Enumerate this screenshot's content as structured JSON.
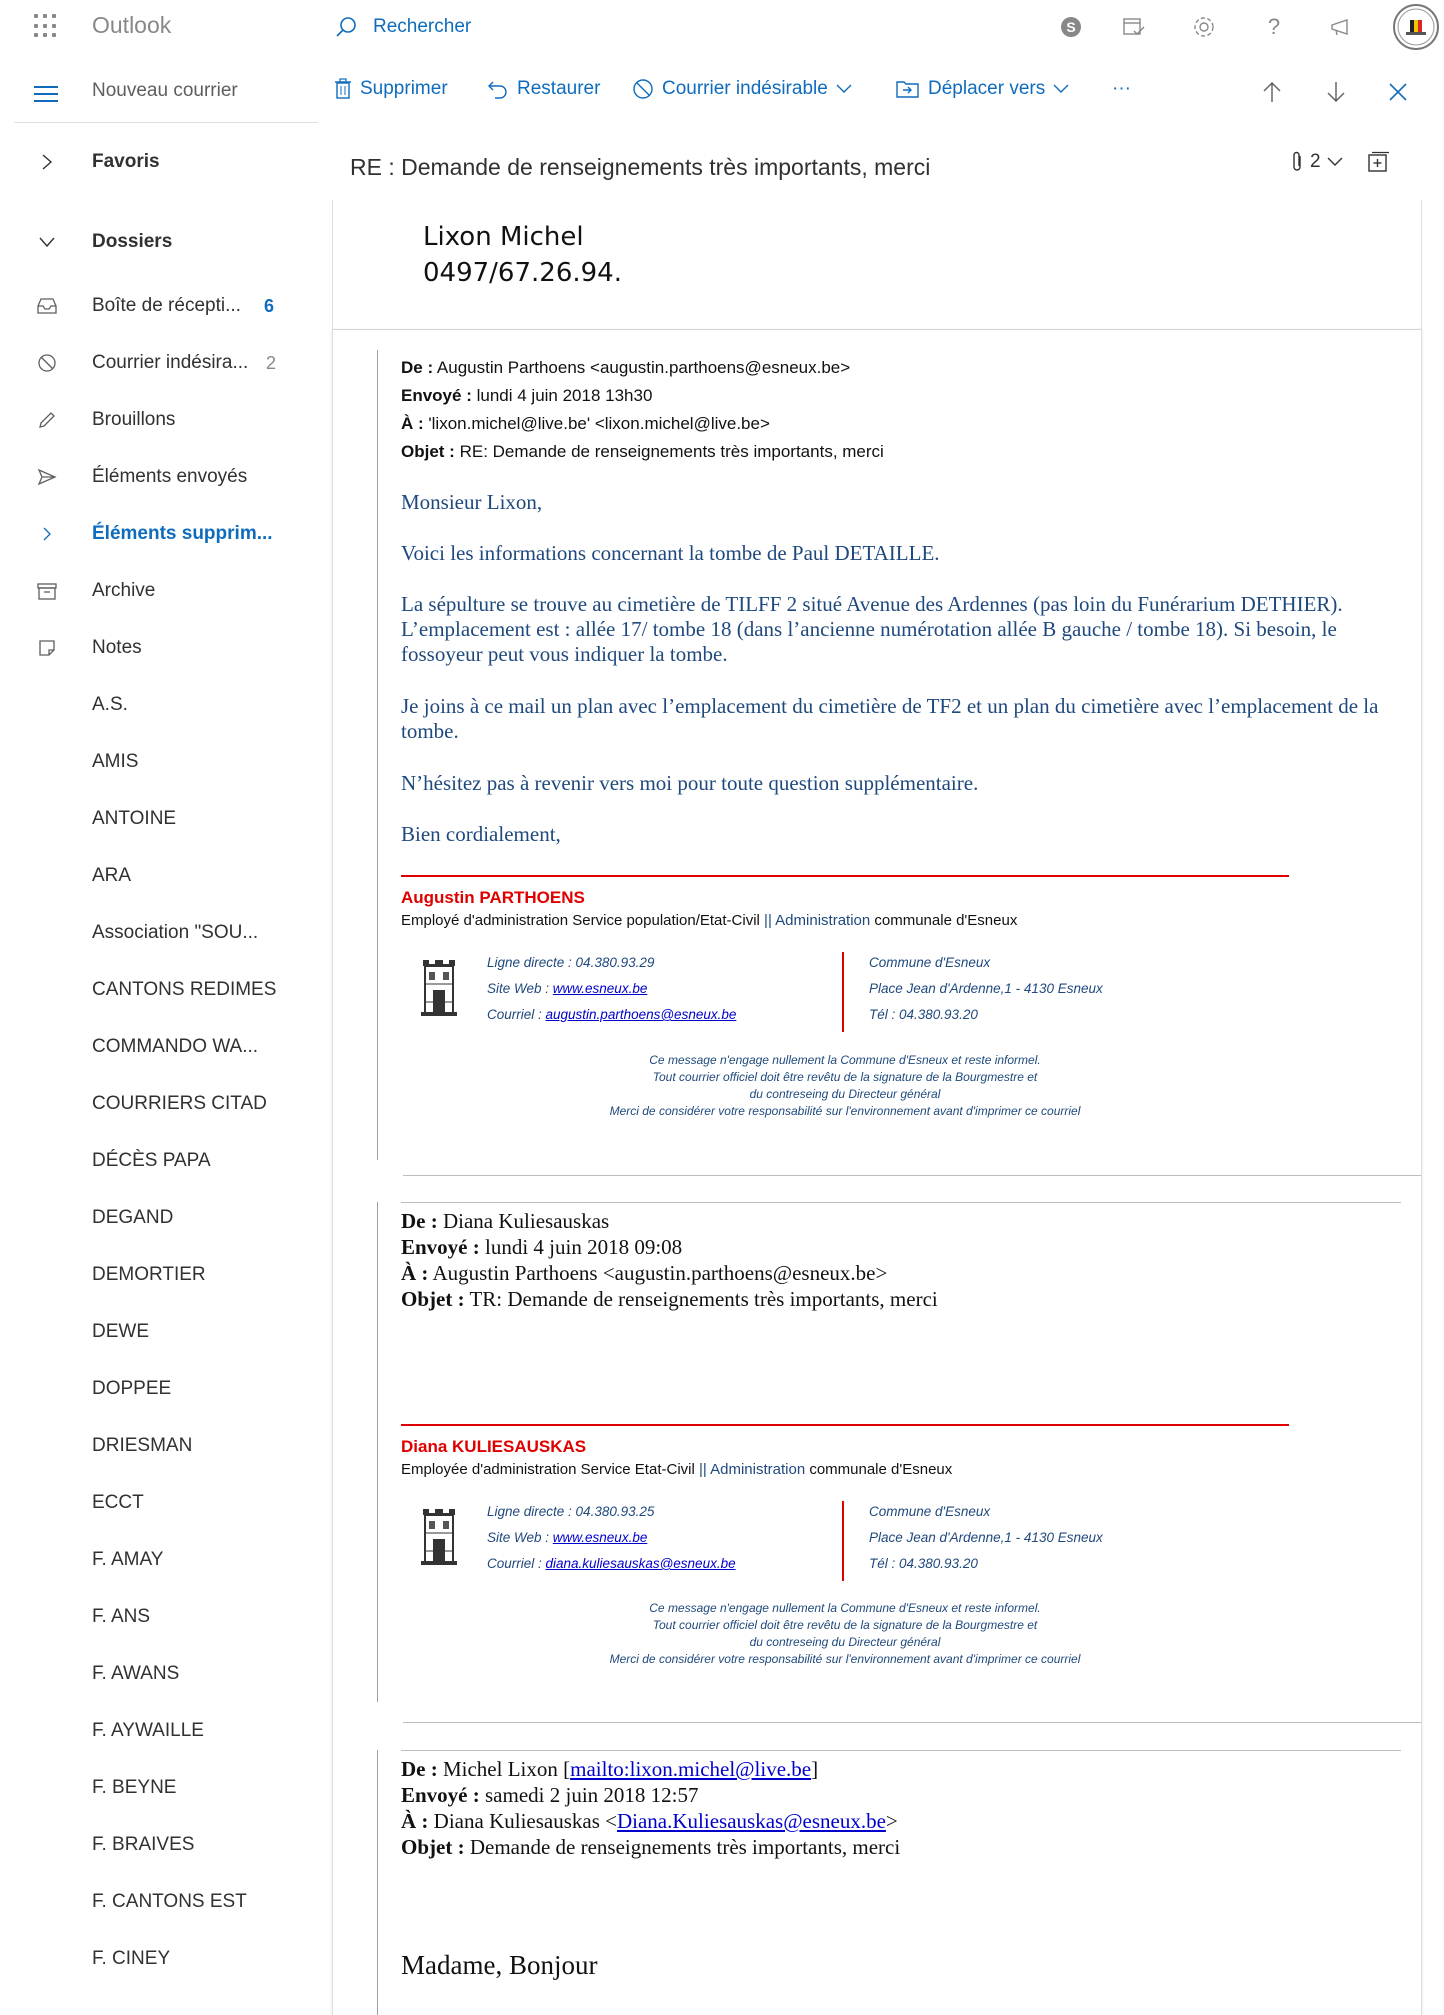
{
  "app": {
    "title": "Outlook",
    "search_label": "Rechercher",
    "new_mail": "Nouveau courrier"
  },
  "toolbar": {
    "delete": "Supprimer",
    "restore": "Restaurer",
    "junk": "Courrier indésirable",
    "move": "Déplacer vers",
    "more": "···"
  },
  "sidebar": {
    "favorites": "Favoris",
    "folders": "Dossiers",
    "items": [
      {
        "label": "Boîte de récepti...",
        "count": "6"
      },
      {
        "label": "Courrier indésira...",
        "count": "2"
      },
      {
        "label": "Brouillons",
        "count": ""
      },
      {
        "label": "Éléments envoyés",
        "count": ""
      },
      {
        "label": "Éléments supprim...",
        "count": ""
      },
      {
        "label": "Archive",
        "count": ""
      },
      {
        "label": "Notes",
        "count": ""
      }
    ],
    "custom": [
      "A.S.",
      "AMIS",
      "ANTOINE",
      "ARA",
      "Association \"SOU...",
      "CANTONS REDIMES",
      "COMMANDO WA...",
      "COURRIERS CITAD",
      "DÉCÈS PAPA",
      "DEGAND",
      "DEMORTIER",
      "DEWE",
      "DOPPEE",
      "DRIESMAN",
      "ECCT",
      "F. AMAY",
      "F. ANS",
      "F. AWANS",
      "F. AYWAILLE",
      "F. BEYNE",
      "F. BRAIVES",
      "F. CANTONS EST",
      "F. CINEY"
    ]
  },
  "message": {
    "subject": "RE : Demande de renseignements très importants, merci",
    "attachments_count": "2",
    "signature_name": "Lixon Michel",
    "signature_phone": "0497/67.26.94."
  },
  "mail1": {
    "from_label": "De :",
    "from": "Augustin Parthoens <augustin.parthoens@esneux.be>",
    "sent_label": "Envoyé :",
    "sent": "lundi 4 juin 2018 13h30",
    "to_label": "À :",
    "to": "'lixon.michel@live.be' <lixon.michel@live.be>",
    "subject_label": "Objet :",
    "subject": "RE: Demande de renseignements très importants, merci",
    "greeting": "Monsieur Lixon,",
    "p1": "Voici les informations concernant la tombe de Paul DETAILLE.",
    "p2": "La sépulture se trouve au cimetière de TILFF 2 situé Avenue des Ardennes (pas loin du Funérarium DETHIER). L’emplacement est : allée 17/ tombe 18 (dans l’ancienne numérotation allée B gauche / tombe 18). Si besoin, le fossoyeur peut vous indiquer la tombe.",
    "p3": "Je joins à ce mail un plan avec l’emplacement du cimetière de TF2 et un plan du cimetière avec l’emplacement de la tombe.",
    "p4": "N’hésitez pas à revenir vers moi pour toute question supplémentaire.",
    "closing": "Bien cordialement,",
    "sig_name": "Augustin PARTHOENS",
    "sig_role_a": "Employé d'administration Service population/Etat-Civil ",
    "sig_role_b": "|| Administration",
    "sig_role_c": " communale d'Esneux",
    "line_direct": "Ligne directe : 04.380.93.29",
    "site_label": "Site Web : ",
    "site": "www.esneux.be",
    "mail_label": "Courriel : ",
    "mail": "augustin.parthoens@esneux.be",
    "commune": "Commune d'Esneux",
    "address": "Place Jean d'Ardenne,1 - 4130 Esneux",
    "tel": "Tél : 04.380.93.20"
  },
  "mail2": {
    "from_label": "De :",
    "from": "Diana Kuliesauskas",
    "sent_label": "Envoyé :",
    "sent": "lundi 4 juin 2018 09:08",
    "to_label": "À :",
    "to": "Augustin Parthoens <augustin.parthoens@esneux.be>",
    "subject_label": "Objet :",
    "subject": "TR: Demande de renseignements très importants, merci",
    "sig_name": "Diana KULIESAUSKAS",
    "sig_role_a": "Employée d'administration Service Etat-Civil ",
    "sig_role_b": "|| Administration",
    "sig_role_c": " communale d'Esneux",
    "line_direct": "Ligne directe : 04.380.93.25",
    "site_label": "Site Web : ",
    "site": "www.esneux.be",
    "mail_label": "Courriel : ",
    "mail": "diana.kuliesauskas@esneux.be",
    "commune": "Commune d'Esneux",
    "address": "Place Jean d'Ardenne,1 - 4130 Esneux",
    "tel": "Tél : 04.380.93.20"
  },
  "disclaimer": {
    "l1": "Ce message n'engage nullement la Commune d'Esneux et reste informel.",
    "l2": "Tout courrier officiel doit être revêtu de la signature de la Bourgmestre et",
    "l3": "du contreseing du Directeur général",
    "l4": "Merci de considérer votre responsabilité sur l'environnement avant d'imprimer ce courriel"
  },
  "mail3": {
    "from_label": "De :",
    "from": "Michel Lixon [",
    "from_link": "mailto:lixon.michel@live.be",
    "from_end": "]",
    "sent_label": "Envoyé :",
    "sent": "samedi 2 juin 2018 12:57",
    "to_label": "À :",
    "to": "Diana Kuliesauskas <",
    "to_link": "Diana.Kuliesauskas@esneux.be",
    "to_end": ">",
    "subject_label": "Objet :",
    "subject": "Demande de renseignements très importants, merci",
    "greeting": "Madame, Bonjour"
  },
  "colors": {
    "accent": "#0f6cbd",
    "quote_text": "#1f497d",
    "sig_red": "#e00000"
  }
}
